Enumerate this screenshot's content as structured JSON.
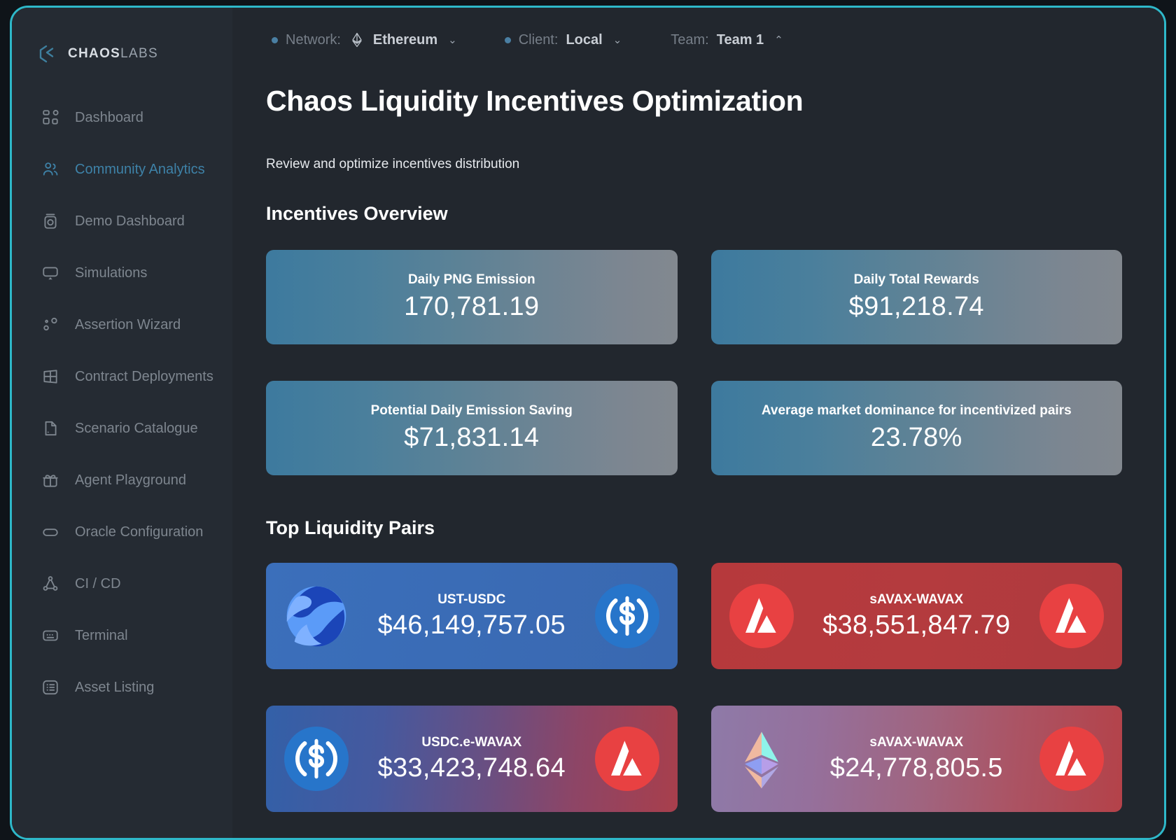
{
  "brand": {
    "name_bold": "CHAOS",
    "name_light": "LABS",
    "logo_icon": "chaos-labs-logo"
  },
  "sidebar": {
    "items": [
      {
        "label": "Dashboard",
        "icon": "grid-dashboard-icon",
        "active": false
      },
      {
        "label": "Community Analytics",
        "icon": "users-icon",
        "active": true
      },
      {
        "label": "Demo Dashboard",
        "icon": "camera-icon",
        "active": false
      },
      {
        "label": "Simulations",
        "icon": "monitor-icon",
        "active": false
      },
      {
        "label": "Assertion Wizard",
        "icon": "nodes-icon",
        "active": false
      },
      {
        "label": "Contract Deployments",
        "icon": "table-icon",
        "active": false
      },
      {
        "label": "Scenario Catalogue",
        "icon": "book-icon",
        "active": false
      },
      {
        "label": "Agent Playground",
        "icon": "gift-icon",
        "active": false
      },
      {
        "label": "Oracle Configuration",
        "icon": "capsule-icon",
        "active": false
      },
      {
        "label": "CI / CD",
        "icon": "pipeline-icon",
        "active": false
      },
      {
        "label": "Terminal",
        "icon": "terminal-icon",
        "active": false
      },
      {
        "label": "Asset Listing",
        "icon": "list-icon",
        "active": false
      }
    ]
  },
  "topbar": {
    "network_label": "Network:",
    "network_value": "Ethereum",
    "network_icon": "ethereum-icon",
    "client_label": "Client:",
    "client_value": "Local",
    "team_label": "Team:",
    "team_value": "Team 1",
    "caret_down": "⌄",
    "caret_up": "⌃"
  },
  "page": {
    "title": "Chaos Liquidity Incentives Optimization",
    "subtitle": "Review and optimize incentives distribution",
    "section_overview": "Incentives Overview",
    "section_pairs": "Top Liquidity Pairs"
  },
  "metrics": [
    {
      "title": "Daily PNG Emission",
      "value": "170,781.19"
    },
    {
      "title": "Daily Total Rewards",
      "value": "$91,218.74"
    },
    {
      "title": "Potential Daily Emission Saving",
      "value": "$71,831.14"
    },
    {
      "title": "Average market dominance for incentivized pairs",
      "value": "23.78%"
    }
  ],
  "pairs": [
    {
      "name": "UST-USDC",
      "value": "$46,149,757.05",
      "left_icon": "ust-token-icon",
      "right_icon": "usdc-token-icon",
      "theme": "g-blue"
    },
    {
      "name": "sAVAX-WAVAX",
      "value": "$38,551,847.79",
      "left_icon": "avax-token-icon",
      "right_icon": "avax-token-icon",
      "theme": "g-red"
    },
    {
      "name": "USDC.e-WAVAX",
      "value": "$33,423,748.64",
      "left_icon": "usdc-token-icon",
      "right_icon": "avax-token-icon",
      "theme": "g-bluered"
    },
    {
      "name": "sAVAX-WAVAX",
      "value": "$24,778,805.5",
      "left_icon": "eth-token-icon",
      "right_icon": "avax-token-icon",
      "theme": "g-purpred"
    }
  ],
  "colors": {
    "frame_border": "#2eb8c9",
    "app_bg": "#22272e",
    "sidebar_bg": "#252b33",
    "active_nav": "#3e82a8",
    "metric_gradient_start": "#3d7a9e",
    "metric_gradient_end": "#82888f"
  }
}
